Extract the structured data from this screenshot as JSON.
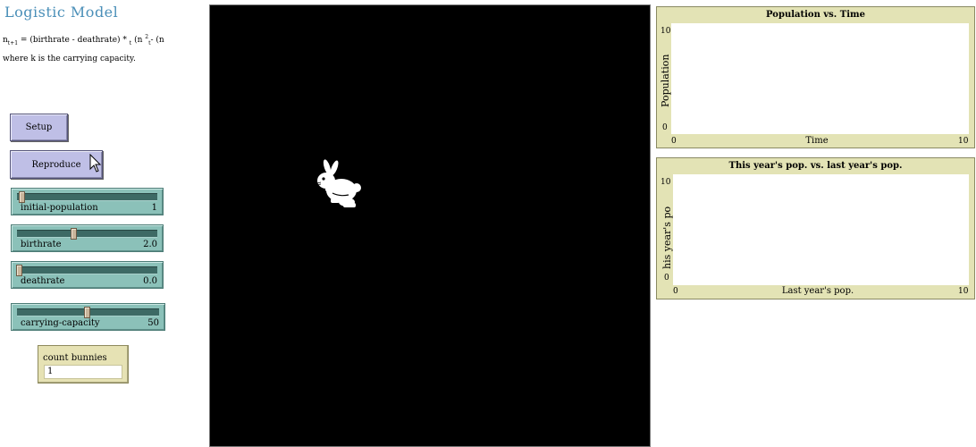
{
  "model": {
    "title": "Logistic Model",
    "formula": {
      "n_left": "n",
      "n_left_sub": "t+1",
      "middle": " = (birthrate - deathrate) * ",
      "t_sub": "t",
      "after": " (n ",
      "exp": "2",
      "tail_sub": "t",
      "tail": "- (n"
    },
    "note": "where k is the carrying capacity."
  },
  "buttons": {
    "setup": "Setup",
    "reproduce": "Reproduce"
  },
  "sliders": [
    {
      "label": "initial-population",
      "value": "1",
      "fraction": 0.02
    },
    {
      "label": "birthrate",
      "value": "2.0",
      "fraction": 0.4
    },
    {
      "label": "deathrate",
      "value": "0.0",
      "fraction": 0.0
    },
    {
      "label": "carrying-capacity",
      "value": "50",
      "fraction": 0.49
    }
  ],
  "monitor": {
    "label": "count bunnies",
    "value": "1"
  },
  "world": {
    "turtle_icon": "rabbit-icon",
    "background": "#000000",
    "turtle_color": "#ffffff"
  },
  "plots": {
    "population_vs_time": {
      "title": "Population vs. Time",
      "ylabel": "Population",
      "xlabel": "Time",
      "xmin": "0",
      "xmax": "10",
      "ymin": "0",
      "ymax": "10"
    },
    "this_vs_last": {
      "title": "This year's pop. vs. last year's pop.",
      "ylabel": "his year's po",
      "xlabel": "Last year's pop.",
      "xmin": "0",
      "xmax": "10",
      "ymin": "0",
      "ymax": "10"
    }
  },
  "colors": {
    "button": "#bfbfe6",
    "slider": "#8bc1b9",
    "monitor": "#e6e2b4",
    "plot_frame": "#e3e3b5",
    "title": "#4a8fb8"
  }
}
